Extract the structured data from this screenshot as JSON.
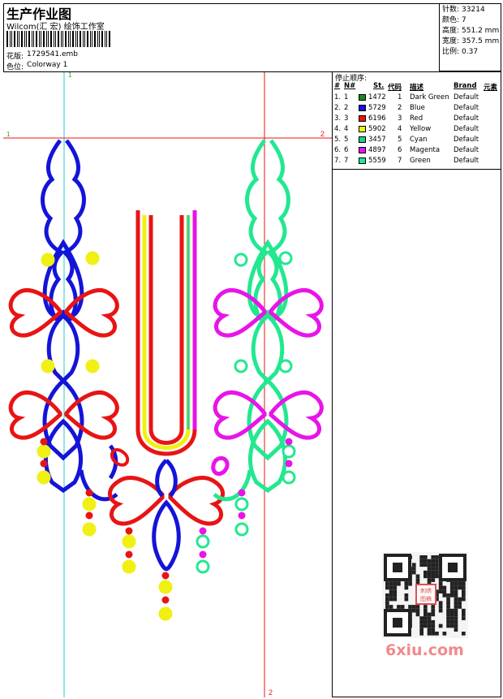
{
  "header": {
    "title": "生产作业图",
    "subtitle": "Wilcom(汇 宏) 绘饰工作室",
    "design_label": "花版:",
    "design_value": "1729541.emb",
    "colorway_label": "色位:",
    "colorway_value": "Colorway 1"
  },
  "info": {
    "stitches_label": "针数:",
    "stitches_value": "33214",
    "colors_label": "颜色:",
    "colors_value": "7",
    "height_label": "高度:",
    "height_value": "551.2 mm",
    "width_label": "宽度:",
    "width_value": "357.5 mm",
    "scale_label": "比例:",
    "scale_value": "0.37"
  },
  "stop_sequence": {
    "title": "停止顺序:",
    "headers": {
      "num": "#",
      "needle": "N#",
      "st": "St.",
      "code": "代码",
      "desc": "描述",
      "brand": "Brand",
      "element": "元素"
    },
    "rows": [
      {
        "num": "1.",
        "needle": "1",
        "color": "#1a8a1a",
        "st": "1472",
        "code": "1",
        "desc": "Dark Green",
        "brand": "Default"
      },
      {
        "num": "2.",
        "needle": "2",
        "color": "#1414d8",
        "st": "5729",
        "code": "2",
        "desc": "Blue",
        "brand": "Default"
      },
      {
        "num": "3.",
        "needle": "3",
        "color": "#e81414",
        "st": "6196",
        "code": "3",
        "desc": "Red",
        "brand": "Default"
      },
      {
        "num": "4.",
        "needle": "4",
        "color": "#f0f014",
        "st": "5902",
        "code": "4",
        "desc": "Yellow",
        "brand": "Default"
      },
      {
        "num": "5.",
        "needle": "5",
        "color": "#22cc88",
        "st": "3457",
        "code": "5",
        "desc": "Cyan",
        "brand": "Default"
      },
      {
        "num": "6.",
        "needle": "6",
        "color": "#e814e8",
        "st": "4897",
        "code": "6",
        "desc": "Magenta",
        "brand": "Default"
      },
      {
        "num": "7.",
        "needle": "7",
        "color": "#22e890",
        "st": "5559",
        "code": "7",
        "desc": "Green",
        "brand": "Default"
      }
    ]
  },
  "markers": {
    "m1_top": "1",
    "m1_left": "1",
    "m2_right": "2",
    "m2_bottom": "2"
  },
  "watermark": "6xiu.com",
  "seal_text": "刺绣图稿",
  "colors": {
    "blue": "#1414d8",
    "red": "#e81414",
    "yellow": "#f0f014",
    "green": "#22e890",
    "magenta": "#e814e8",
    "cyan_line": "#22cccc",
    "red_line": "#e81414"
  }
}
